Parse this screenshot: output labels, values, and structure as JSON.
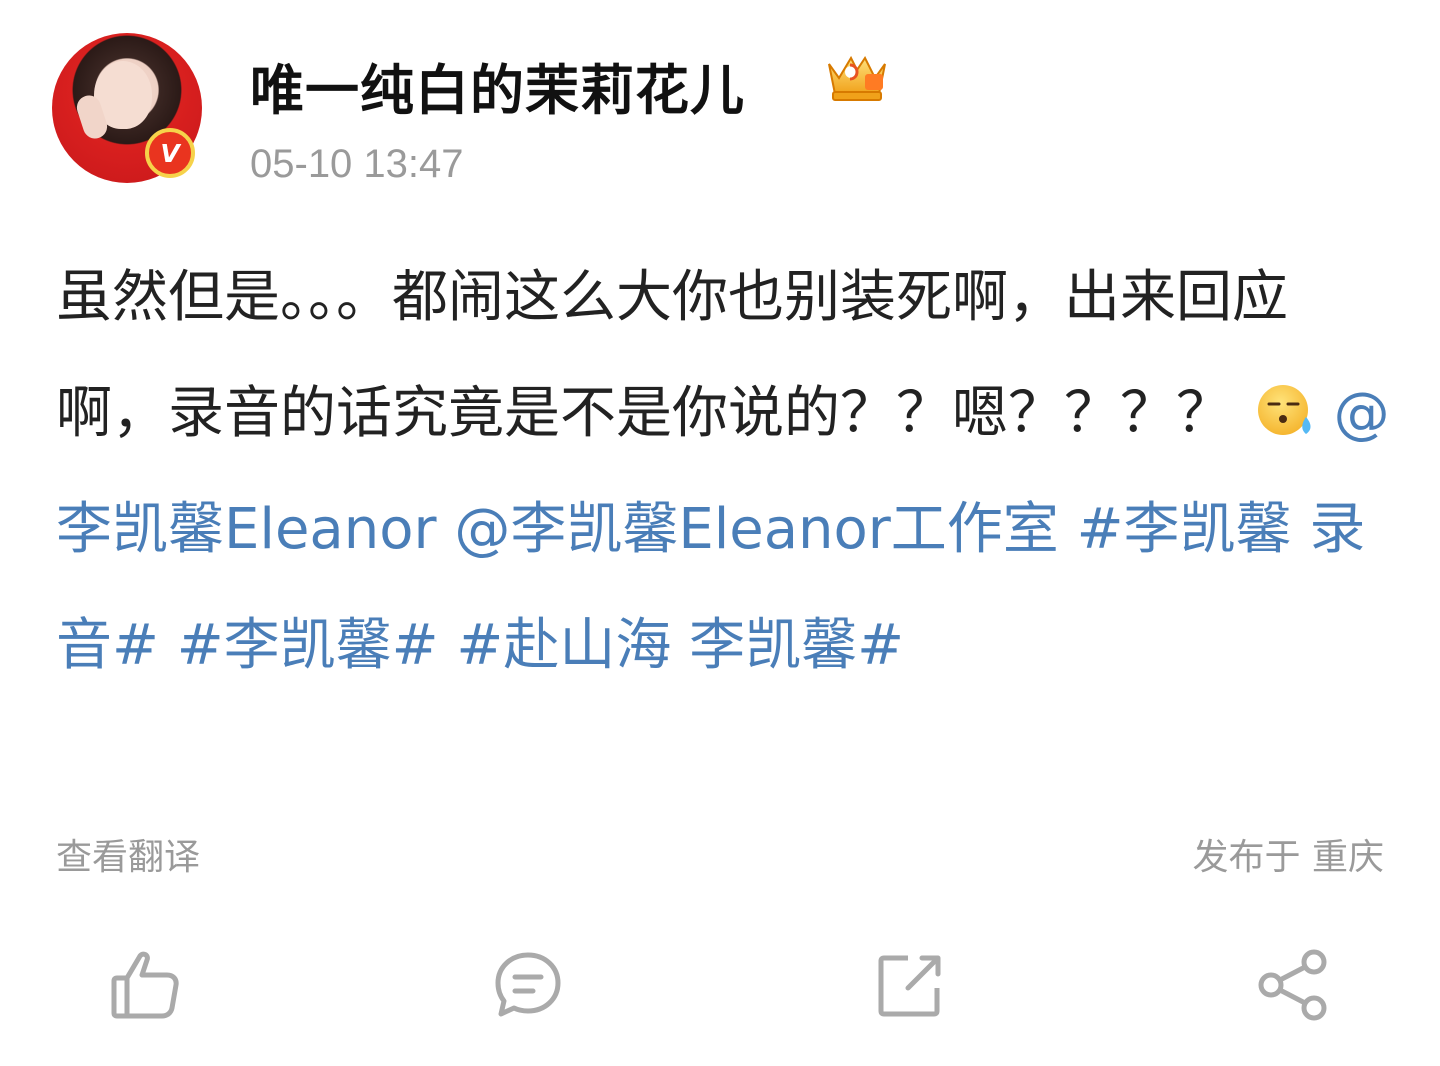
{
  "post": {
    "author_name": "唯一纯白的茉莉花儿",
    "timestamp": "05-10 13:47",
    "verified_badge_text": "V",
    "text_main": "虽然但是。。。都闹这么大你也别装死啊，出来回应啊，录音的话究竟是不是你说的？？嗯？？？？",
    "emoji": "sweat-emoji",
    "mentions": [
      "@李凯馨Eleanor",
      "@李凯馨Eleanor工作室"
    ],
    "hashtags": [
      "#李凯馨 录音#",
      "#李凯馨#",
      "#赴山海 李凯馨#"
    ]
  },
  "footer": {
    "translate_label": "查看翻译",
    "location_text": "发布于 重庆"
  },
  "actions": [
    {
      "name": "like",
      "icon": "thumbs-up-icon"
    },
    {
      "name": "comment",
      "icon": "comment-icon"
    },
    {
      "name": "repost",
      "icon": "repost-icon"
    },
    {
      "name": "share",
      "icon": "share-icon"
    }
  ],
  "colors": {
    "link": "#4a7eb8",
    "muted": "#9a9a9a",
    "text": "#222222",
    "badge_red": "#e9341f",
    "badge_gold": "#f6d24a"
  }
}
